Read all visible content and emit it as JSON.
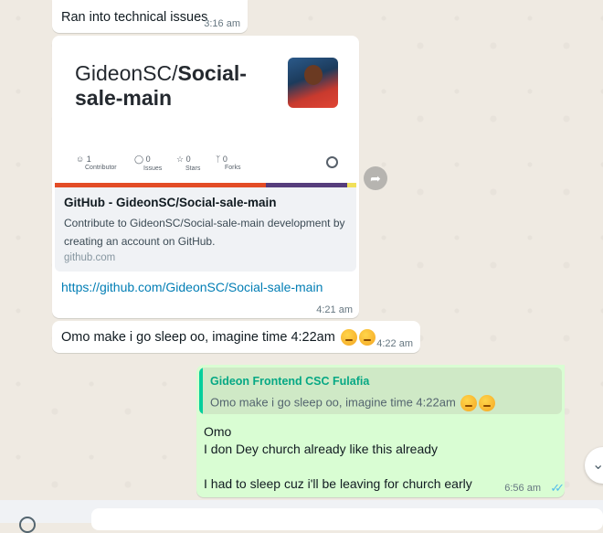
{
  "messages": {
    "m1": {
      "text": "Ran into technical issues",
      "time": "3:16 am"
    },
    "m2": {
      "preview": {
        "repo_owner": "GideonSC/",
        "repo_name": "Social-sale-main",
        "stats": [
          {
            "icon": "contributors-icon",
            "count": "1",
            "label": "Contributor"
          },
          {
            "icon": "issues-icon",
            "count": "0",
            "label": "Issues"
          },
          {
            "icon": "star-icon",
            "count": "0",
            "label": "Stars"
          },
          {
            "icon": "fork-icon",
            "count": "0",
            "label": "Forks"
          }
        ],
        "title": "GitHub - GideonSC/Social-sale-main",
        "description": "Contribute to GideonSC/Social-sale-main development by creating an account on GitHub.",
        "domain": "github.com",
        "lang_colors": [
          "#e34c26",
          "#563d7c",
          "#f1e05a"
        ]
      },
      "link": "https://github.com/GideonSC/Social-sale-main",
      "time": "4:21 am"
    },
    "m3": {
      "text": "Omo make i go sleep oo, imagine time 4:22am",
      "emojis": [
        "sleepy-face",
        "sleeping-face"
      ],
      "time": "4:22 am"
    },
    "m4": {
      "quote": {
        "author": "Gideon Frontend CSC Fulafia",
        "text": "Omo make i go sleep oo, imagine time 4:22am"
      },
      "lines": [
        "Omo",
        "I don Dey church already like this already",
        "",
        "I had to sleep cuz i'll be leaving for church early"
      ],
      "time": "6:56 am",
      "status": "read"
    }
  },
  "colors": {
    "incoming": "#ffffff",
    "outgoing": "#d9fdd3",
    "link": "#027eb5",
    "read_ticks": "#53bdeb"
  }
}
